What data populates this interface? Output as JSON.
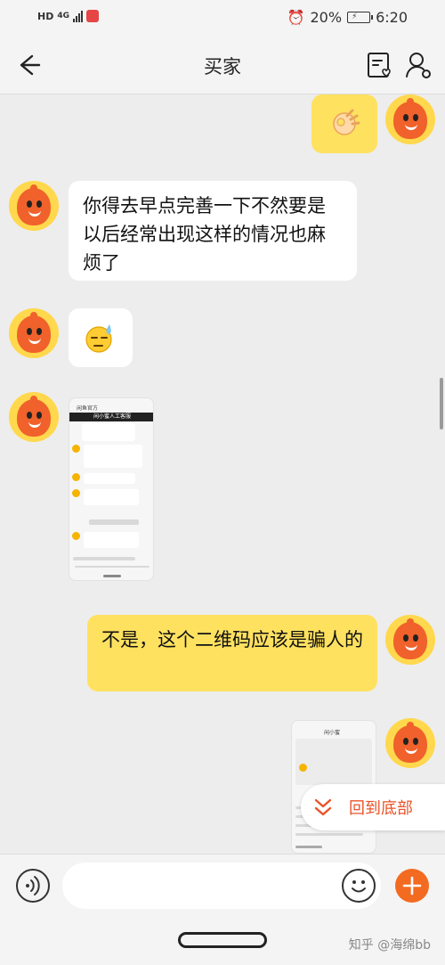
{
  "status_bar": {
    "hd": "HD",
    "network": "4G",
    "battery": "20%",
    "time": "6:20"
  },
  "header": {
    "title": "买家"
  },
  "messages": [
    {
      "side": "right",
      "type": "emoji",
      "icon": "ok-hand-emoji"
    },
    {
      "side": "left",
      "type": "text",
      "text": "你得去早点完善一下不然要是以后经常出现这样的情况也麻烦了"
    },
    {
      "side": "left",
      "type": "emoji",
      "icon": "sweat-face-emoji"
    },
    {
      "side": "left",
      "type": "image"
    },
    {
      "side": "right",
      "type": "text",
      "text": "不是，这个二维码应该是骗人的"
    },
    {
      "side": "right",
      "type": "image"
    }
  ],
  "thumb1": {
    "top_label": "闲鱼官方",
    "header": "闲小蜜人工客服"
  },
  "thumb2": {
    "header": "闲小蜜"
  },
  "scroll_to_bottom": "回到底部",
  "input": {
    "placeholder": ""
  },
  "watermark": "知乎 @海绵bb",
  "colors": {
    "accent": "#f36b21",
    "bubble_yellow": "#ffe160",
    "link_orange": "#e8542a"
  }
}
